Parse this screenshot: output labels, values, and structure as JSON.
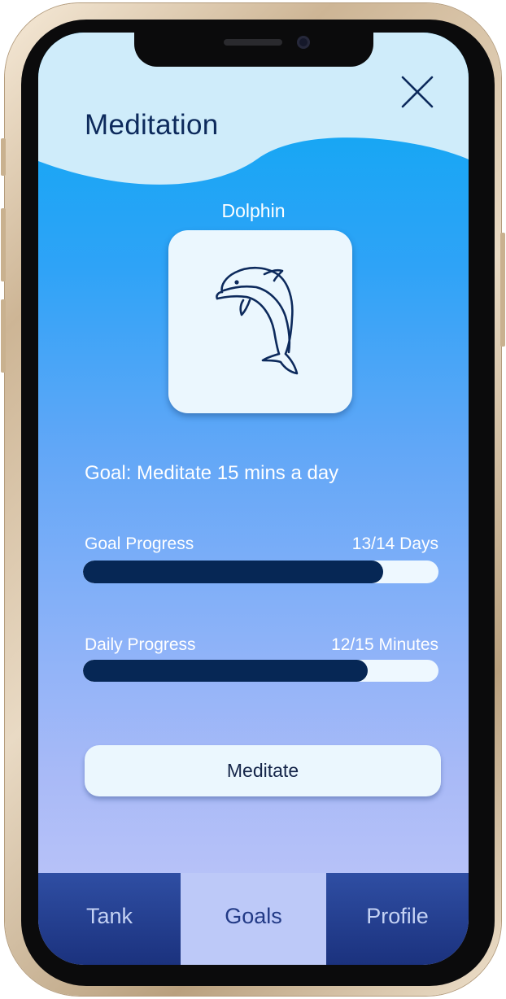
{
  "header": {
    "title": "Meditation"
  },
  "pet": {
    "name": "Dolphin",
    "icon": "dolphin-icon"
  },
  "goal": {
    "text": "Goal: Meditate 15 mins a day"
  },
  "goal_progress": {
    "label": "Goal Progress",
    "value_text": "13/14 Days",
    "fraction": 0.844
  },
  "daily_progress": {
    "label": "Daily Progress",
    "value_text": "12/15 Minutes",
    "fraction": 0.8
  },
  "actions": {
    "meditate_label": "Meditate"
  },
  "tabs": [
    {
      "label": "Tank",
      "active": false
    },
    {
      "label": "Goals",
      "active": true
    },
    {
      "label": "Profile",
      "active": false
    }
  ],
  "colors": {
    "accent_dark": "#062755",
    "title": "#0d2a5c",
    "card": "#ebf7fe",
    "tab_active": "#bdc9f8",
    "tab_inactive": "#1f3a8a"
  }
}
